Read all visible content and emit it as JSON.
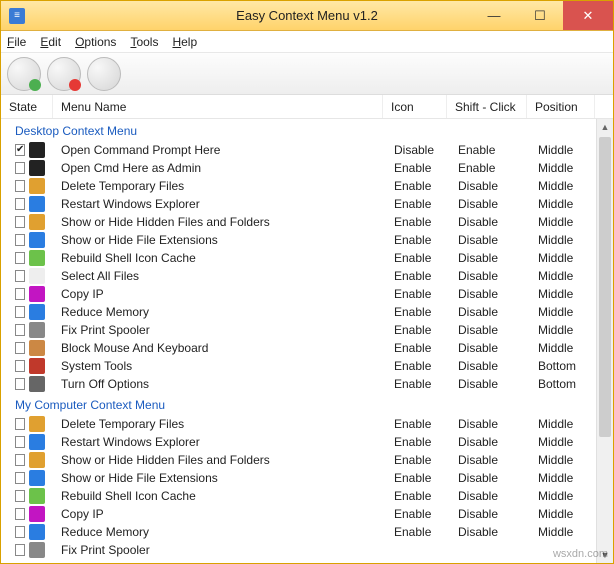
{
  "window": {
    "title": "Easy Context Menu v1.2"
  },
  "menubar": {
    "items": [
      {
        "label": "File",
        "accel": "F"
      },
      {
        "label": "Edit",
        "accel": "E"
      },
      {
        "label": "Options",
        "accel": "O"
      },
      {
        "label": "Tools",
        "accel": "T"
      },
      {
        "label": "Help",
        "accel": "H"
      }
    ]
  },
  "toolbar": {
    "buttons": [
      {
        "name": "tool-add",
        "variant": "add"
      },
      {
        "name": "tool-remove",
        "variant": "del"
      },
      {
        "name": "tool-settings",
        "variant": "set"
      }
    ]
  },
  "columns": {
    "state": "State",
    "menu": "Menu Name",
    "icon": "Icon",
    "shift": "Shift - Click",
    "pos": "Position"
  },
  "groups": [
    {
      "title": "Desktop Context Menu",
      "rows": [
        {
          "checked": true,
          "icon": "cmd-icon",
          "iconColor": "#222",
          "name": "Open Command Prompt Here",
          "iconCol": "Disable",
          "shift": "Enable",
          "pos": "Middle"
        },
        {
          "checked": false,
          "icon": "cmd-admin-icon",
          "iconColor": "#222",
          "name": "Open Cmd Here as Admin",
          "iconCol": "Enable",
          "shift": "Enable",
          "pos": "Middle"
        },
        {
          "checked": false,
          "icon": "broom-icon",
          "iconColor": "#e0a030",
          "name": "Delete Temporary Files",
          "iconCol": "Enable",
          "shift": "Disable",
          "pos": "Middle"
        },
        {
          "checked": false,
          "icon": "restart-icon",
          "iconColor": "#2a7de1",
          "name": "Restart Windows Explorer",
          "iconCol": "Enable",
          "shift": "Disable",
          "pos": "Middle"
        },
        {
          "checked": false,
          "icon": "folder-icon",
          "iconColor": "#e0a030",
          "name": "Show or Hide Hidden Files and Folders",
          "iconCol": "Enable",
          "shift": "Disable",
          "pos": "Middle"
        },
        {
          "checked": false,
          "icon": "ext-icon",
          "iconColor": "#2a7de1",
          "name": "Show or Hide File Extensions",
          "iconCol": "Enable",
          "shift": "Disable",
          "pos": "Middle"
        },
        {
          "checked": false,
          "icon": "cache-icon",
          "iconColor": "#6cc24a",
          "name": "Rebuild Shell Icon Cache",
          "iconCol": "Enable",
          "shift": "Disable",
          "pos": "Middle"
        },
        {
          "checked": false,
          "icon": "select-all-icon",
          "iconColor": "#eee",
          "name": "Select All Files",
          "iconCol": "Enable",
          "shift": "Disable",
          "pos": "Middle"
        },
        {
          "checked": false,
          "icon": "ip-icon",
          "iconColor": "#c215c2",
          "name": "Copy IP",
          "iconCol": "Enable",
          "shift": "Disable",
          "pos": "Middle"
        },
        {
          "checked": false,
          "icon": "memory-icon",
          "iconColor": "#2a7de1",
          "name": "Reduce Memory",
          "iconCol": "Enable",
          "shift": "Disable",
          "pos": "Middle"
        },
        {
          "checked": false,
          "icon": "printer-icon",
          "iconColor": "#888",
          "name": "Fix Print Spooler",
          "iconCol": "Enable",
          "shift": "Disable",
          "pos": "Middle"
        },
        {
          "checked": false,
          "icon": "keyboard-icon",
          "iconColor": "#cc8844",
          "name": "Block Mouse And Keyboard",
          "iconCol": "Enable",
          "shift": "Disable",
          "pos": "Middle"
        },
        {
          "checked": false,
          "icon": "tools-icon",
          "iconColor": "#c0392b",
          "name": "System Tools",
          "iconCol": "Enable",
          "shift": "Disable",
          "pos": "Bottom"
        },
        {
          "checked": false,
          "icon": "power-icon",
          "iconColor": "#666",
          "name": "Turn Off Options",
          "iconCol": "Enable",
          "shift": "Disable",
          "pos": "Bottom"
        }
      ]
    },
    {
      "title": "My Computer Context Menu",
      "rows": [
        {
          "checked": false,
          "icon": "broom-icon",
          "iconColor": "#e0a030",
          "name": "Delete Temporary Files",
          "iconCol": "Enable",
          "shift": "Disable",
          "pos": "Middle"
        },
        {
          "checked": false,
          "icon": "restart-icon",
          "iconColor": "#2a7de1",
          "name": "Restart Windows Explorer",
          "iconCol": "Enable",
          "shift": "Disable",
          "pos": "Middle"
        },
        {
          "checked": false,
          "icon": "folder-icon",
          "iconColor": "#e0a030",
          "name": "Show or Hide Hidden Files and Folders",
          "iconCol": "Enable",
          "shift": "Disable",
          "pos": "Middle"
        },
        {
          "checked": false,
          "icon": "ext-icon",
          "iconColor": "#2a7de1",
          "name": "Show or Hide File Extensions",
          "iconCol": "Enable",
          "shift": "Disable",
          "pos": "Middle"
        },
        {
          "checked": false,
          "icon": "cache-icon",
          "iconColor": "#6cc24a",
          "name": "Rebuild Shell Icon Cache",
          "iconCol": "Enable",
          "shift": "Disable",
          "pos": "Middle"
        },
        {
          "checked": false,
          "icon": "ip-icon",
          "iconColor": "#c215c2",
          "name": "Copy IP",
          "iconCol": "Enable",
          "shift": "Disable",
          "pos": "Middle"
        },
        {
          "checked": false,
          "icon": "memory-icon",
          "iconColor": "#2a7de1",
          "name": "Reduce Memory",
          "iconCol": "Enable",
          "shift": "Disable",
          "pos": "Middle"
        },
        {
          "checked": false,
          "icon": "printer-icon",
          "iconColor": "#888",
          "name": "Fix Print Spooler",
          "iconCol": "",
          "shift": "",
          "pos": ""
        }
      ]
    }
  ],
  "watermark": "wsxdn.com"
}
